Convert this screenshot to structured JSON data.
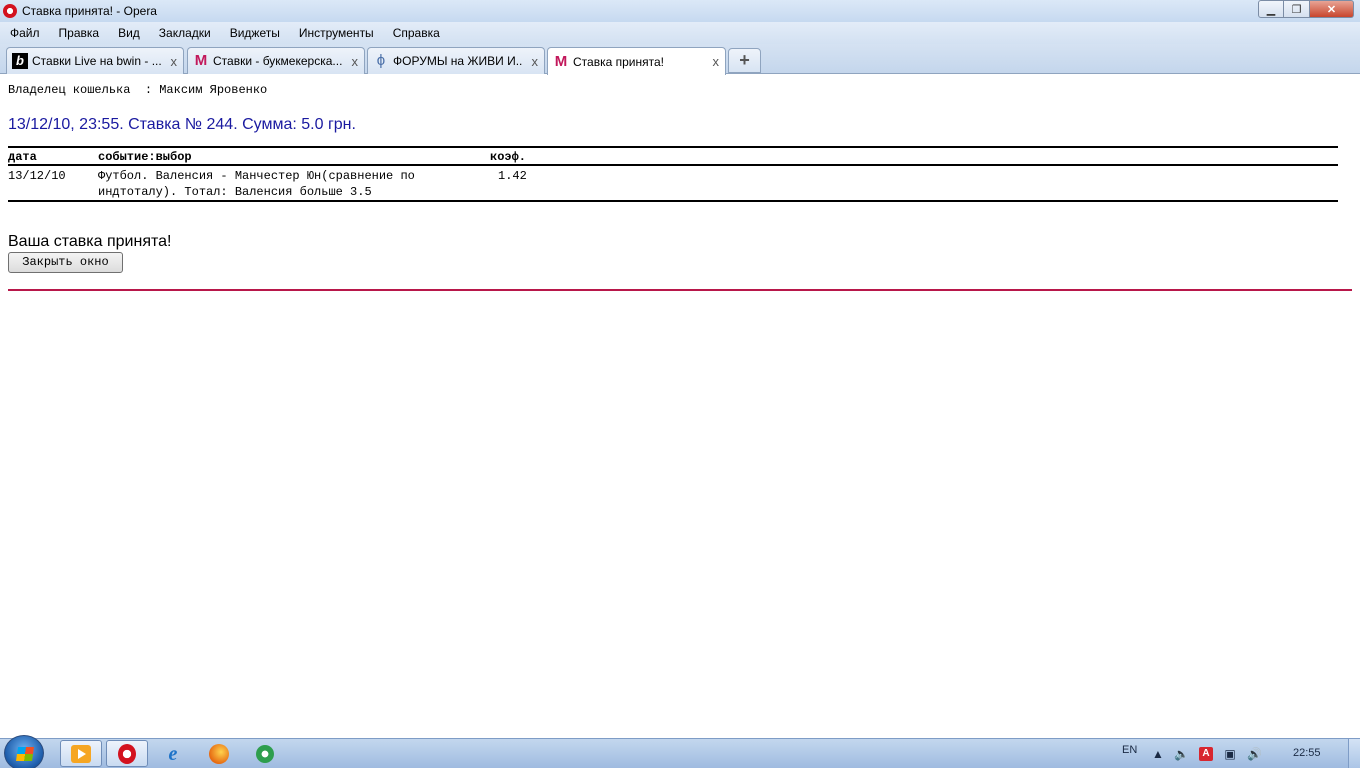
{
  "window": {
    "title": "Ставка принята! - Opera",
    "minimize_icon": "minimize-icon",
    "maximize_icon": "restore-icon",
    "close_icon": "close-icon"
  },
  "menu": [
    "Файл",
    "Правка",
    "Вид",
    "Закладки",
    "Виджеты",
    "Инструменты",
    "Справка"
  ],
  "tabs": [
    {
      "label": "Ставки Live на bwin - ...",
      "icon": "bwin-icon",
      "active": false
    },
    {
      "label": "Ставки - букмекерска...",
      "icon": "marathon-m-icon",
      "active": false
    },
    {
      "label": "ФОРУМЫ на ЖИВИ И...",
      "icon": "forum-icon",
      "active": false
    },
    {
      "label": "Ставка принята!",
      "icon": "marathon-m-icon",
      "active": true
    }
  ],
  "tab_close_glyph": "x",
  "new_tab_glyph": "+",
  "page": {
    "owner_line": "Владелец кошелька  : Максим Яровенко",
    "bet_heading": "13/12/10, 23:55. Ставка № 244. Сумма: 5.0 грн.",
    "table": {
      "headers": {
        "date": "дата",
        "event": "событие:выбор",
        "odds": "коэф."
      },
      "rows": [
        {
          "date": "13/12/10",
          "event_line1": "Футбол. Валенсия - Манчестер Юн(сравнение по",
          "event_line2": "индтоталу). Тотал: Валенсия больше 3.5",
          "odds": "1.42"
        }
      ]
    },
    "accepted_text": "Ваша ставка принята!",
    "close_button": "Закрыть окно",
    "separator_color": "#b8174a",
    "heading_color": "#1a1aa0"
  },
  "taskbar": {
    "language": "EN",
    "clock": "22:55",
    "pinned": [
      "media-player-icon",
      "opera-icon",
      "internet-explorer-icon",
      "firefox-icon",
      "green-app-icon"
    ]
  }
}
